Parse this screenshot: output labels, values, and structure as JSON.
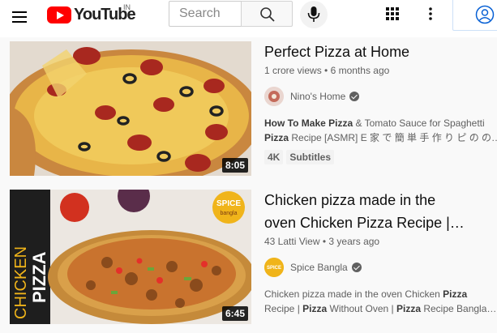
{
  "header": {
    "logo_text": "YouTube",
    "region": "IN",
    "search_placeholder": "Search",
    "brand_color": "#ff0000"
  },
  "results": [
    {
      "title": "Perfect Pizza at Home",
      "views": "1 crore views",
      "age": "6 months ago",
      "channel": "Nino's Home",
      "verified": true,
      "description_parts": [
        {
          "text": "How To Make Pizza",
          "bold": true
        },
        {
          "text": " & Tomato Sauce for Spaghetti ",
          "bold": false
        }
      ],
      "description_line2_parts": [
        {
          "text": "Pizza",
          "bold": true
        },
        {
          "text": " Recipe [ASMR] E 家 で 簡 単 手 作 り ピ の の…",
          "bold": false
        }
      ],
      "badges": [
        "4K",
        "Subtitles"
      ],
      "duration": "8:05"
    },
    {
      "title_line1": "Chicken pizza made in the",
      "title_line2": "oven Chicken Pizza Recipe |…",
      "views": "43 Latti View",
      "age": "3 years ago",
      "channel": "Spice Bangla",
      "verified": true,
      "description_parts": [
        {
          "text": "Chicken pizza made in the oven Chicken ",
          "bold": false
        },
        {
          "text": "Pizza",
          "bold": true
        }
      ],
      "description_line2_parts": [
        {
          "text": "Recipe | ",
          "bold": false
        },
        {
          "text": "Pizza",
          "bold": true
        },
        {
          "text": " Without Oven | ",
          "bold": false
        },
        {
          "text": "Pizza",
          "bold": true
        },
        {
          "text": " Recipe Bangla…",
          "bold": false
        }
      ],
      "duration": "6:45",
      "thumb_text_line1": "CHICKEN",
      "thumb_text_line2": "PIZZA",
      "thumb_logo_line1": "SPICE",
      "thumb_logo_line2": "bangla"
    }
  ]
}
